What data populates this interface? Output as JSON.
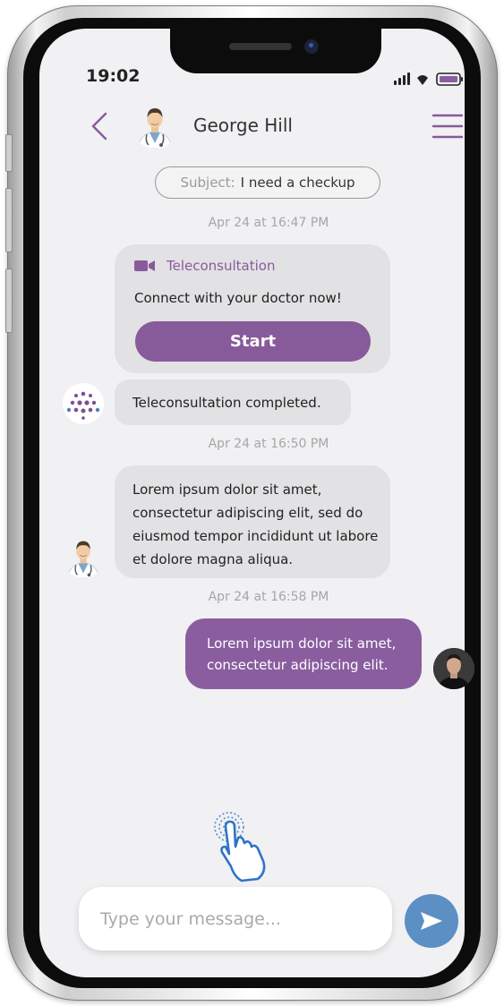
{
  "status_bar": {
    "time": "19:02"
  },
  "header": {
    "contact_name": "George Hill"
  },
  "subject": {
    "label": "Subject:",
    "value": "I need a checkup"
  },
  "messages": {
    "timestamp_1": "Apr 24 at 16:47 PM",
    "teleconsult_card": {
      "title": "Teleconsultation",
      "text": "Connect with your doctor now!",
      "button_label": "Start"
    },
    "completed_text": "Teleconsultation completed.",
    "timestamp_2": "Apr 24 at 16:50 PM",
    "doctor_message": "Lorem ipsum dolor sit amet, consectetur adipiscing elit, sed do eiusmod tempor incididunt ut labore et dolore magna aliqua.",
    "timestamp_3": "Apr 24 at 16:58 PM",
    "user_message": "Lorem ipsum dolor sit amet, consectetur adipiscing elit."
  },
  "composer": {
    "placeholder": "Type your message..."
  },
  "icons": {
    "back": "chevron-left-icon",
    "menu": "hamburger-menu-icon",
    "video": "video-camera-icon",
    "send": "paper-plane-icon",
    "tap_hint": "tap-hand-icon"
  },
  "colors": {
    "accent_purple": "#875a9a",
    "send_blue": "#5c8fc4",
    "screen_bg": "#f1f0f2",
    "incoming_bubble": "#e2e1e3"
  }
}
